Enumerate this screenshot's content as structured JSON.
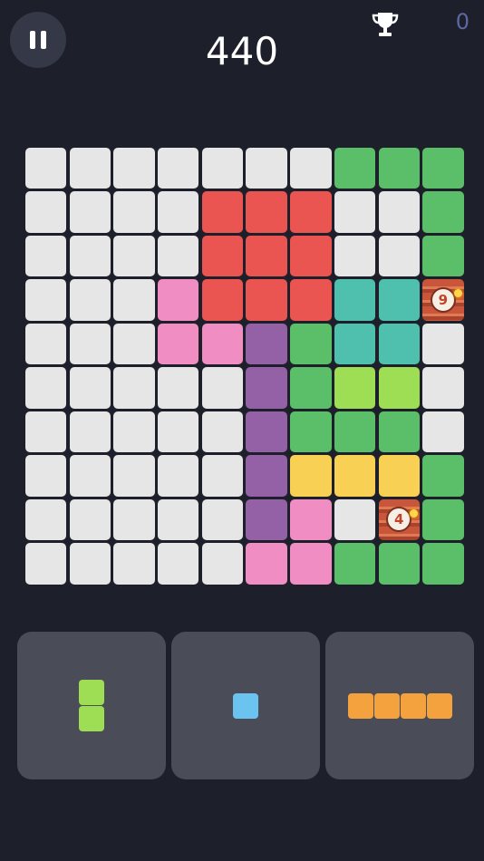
{
  "header": {
    "score": "440",
    "best_score": "0",
    "pause_icon": "pause-icon",
    "trophy_icon": "trophy-icon"
  },
  "colors": {
    "E": "#e6e6e6",
    "G": "#5bbf6a",
    "R": "#ea5451",
    "P": "#f08dc3",
    "T": "#4fbfae",
    "V": "#9460a6",
    "L": "#9ede55",
    "Y": "#f8d154",
    "O": "#f4a23d",
    "C": "#6ac4ef"
  },
  "board": {
    "rows": [
      [
        "E",
        "E",
        "E",
        "E",
        "E",
        "E",
        "E",
        "G",
        "G",
        "G"
      ],
      [
        "E",
        "E",
        "E",
        "E",
        "R",
        "R",
        "R",
        "E",
        "E",
        "G"
      ],
      [
        "E",
        "E",
        "E",
        "E",
        "R",
        "R",
        "R",
        "E",
        "E",
        "G"
      ],
      [
        "E",
        "E",
        "E",
        "P",
        "R",
        "R",
        "R",
        "T",
        "T",
        "B9"
      ],
      [
        "E",
        "E",
        "E",
        "P",
        "P",
        "V",
        "G",
        "T",
        "T",
        "E"
      ],
      [
        "E",
        "E",
        "E",
        "E",
        "E",
        "V",
        "G",
        "L",
        "L",
        "E"
      ],
      [
        "E",
        "E",
        "E",
        "E",
        "E",
        "V",
        "G",
        "G",
        "G",
        "E"
      ],
      [
        "E",
        "E",
        "E",
        "E",
        "E",
        "V",
        "Y",
        "Y",
        "Y",
        "G"
      ],
      [
        "E",
        "E",
        "E",
        "E",
        "E",
        "V",
        "P",
        "E",
        "B4",
        "G"
      ],
      [
        "E",
        "E",
        "E",
        "E",
        "E",
        "P",
        "P",
        "G",
        "G",
        "G"
      ]
    ],
    "bombs": {
      "B9": "9",
      "B4": "4"
    }
  },
  "pieces": [
    {
      "name": "piece-vertical-domino",
      "color": "L",
      "cells": [
        [
          0,
          0
        ],
        [
          1,
          0
        ]
      ]
    },
    {
      "name": "piece-single-square",
      "color": "C",
      "cells": [
        [
          0,
          0
        ]
      ]
    },
    {
      "name": "piece-horizontal-four",
      "color": "O",
      "cells": [
        [
          0,
          0
        ],
        [
          0,
          1
        ],
        [
          0,
          2
        ],
        [
          0,
          3
        ]
      ]
    }
  ]
}
